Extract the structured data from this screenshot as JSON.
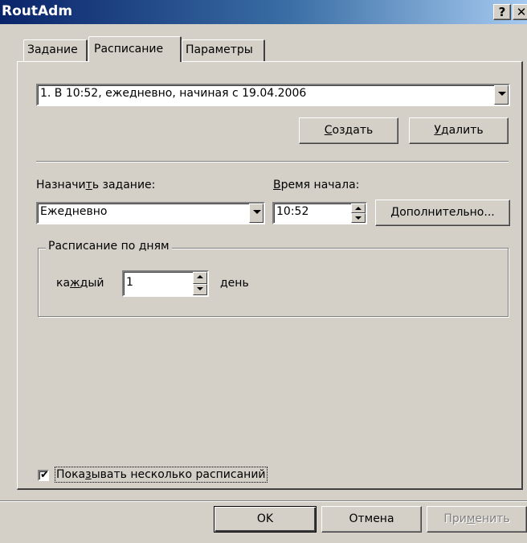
{
  "window": {
    "title": "RoutAdm",
    "help_label": "?",
    "close_label": "✕"
  },
  "tabs": [
    {
      "label": "Задание"
    },
    {
      "label": "Расписание"
    },
    {
      "label": "Параметры"
    }
  ],
  "schedule": {
    "list_value": "1. В 10:52, ежедневно, начиная с 19.04.2006",
    "create_pre": "",
    "create_u": "С",
    "create_post": "оздать",
    "delete_pre": "",
    "delete_u": "У",
    "delete_post": "далить"
  },
  "assign": {
    "label_pre": "Назначи",
    "label_u": "т",
    "label_post": "ь задание:",
    "value": "Ежедневно"
  },
  "start_time": {
    "label_pre": "",
    "label_u": "В",
    "label_post": "ремя начала:",
    "value": "10:52",
    "advanced_pre": "",
    "advanced_u": "Д",
    "advanced_post": "ополнительно..."
  },
  "daily": {
    "group_label": "Расписание по дням",
    "every_pre": "ка",
    "every_u": "ж",
    "every_post": "дый",
    "every_value": "1",
    "unit": "день"
  },
  "show_multiple": {
    "checked": true,
    "label_pre": "Пока",
    "label_u": "з",
    "label_post": "ывать несколько расписаний"
  },
  "footer": {
    "ok_label": "OK",
    "cancel_label": "Отмена",
    "apply_pre": "При",
    "apply_u": "м",
    "apply_post": "енить"
  }
}
